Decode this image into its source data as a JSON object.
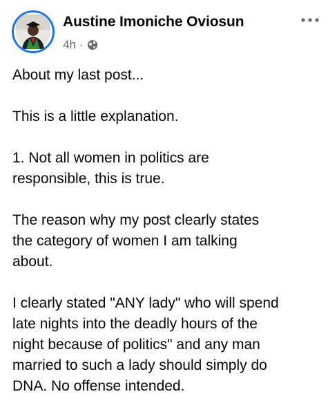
{
  "post": {
    "author_name": "Austine Imoniche Oviosun",
    "timestamp": "4h",
    "separator": "·",
    "audience_icon": "globe-icon",
    "more_icon": "more-options-icon",
    "paragraphs": [
      "About my last post...",
      "This is a little explanation.",
      "1. Not all women in politics are\nresponsible, this is true.",
      "The reason why my post clearly states\nthe category of women I am talking\nabout.",
      "I clearly stated \"ANY lady\" who will spend\nlate nights into the deadly hours of the\nnight because of politics\" and any man\nmarried to such a lady should simply do\nDNA. No offense intended."
    ]
  },
  "colors": {
    "avatar_ring": "#1877f2",
    "text_primary": "#050505",
    "text_secondary": "#65676b",
    "background": "#ffffff"
  }
}
